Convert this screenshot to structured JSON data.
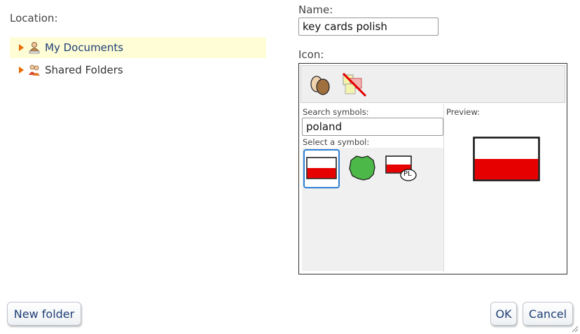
{
  "location": {
    "label": "Location:",
    "items": [
      {
        "label": "My Documents",
        "selected": true
      },
      {
        "label": "Shared Folders",
        "selected": false
      }
    ]
  },
  "name_field": {
    "label": "Name:",
    "value": "key cards polish"
  },
  "icon": {
    "label": "Icon:",
    "search_label": "Search symbols:",
    "search_value": "poland",
    "select_label": "Select a symbol:",
    "preview_label": "Preview:",
    "symbols": [
      "poland-flag",
      "poland-map",
      "poland-flag-pl"
    ],
    "selected_symbol": "poland-flag",
    "pl_text": "PL"
  },
  "buttons": {
    "new_folder": "New folder",
    "ok": "OK",
    "cancel": "Cancel"
  },
  "colors": {
    "accent": "#2d7fd2",
    "flag_red": "#e60000",
    "highlight": "#fefdd6",
    "expander": "#e86c00"
  }
}
